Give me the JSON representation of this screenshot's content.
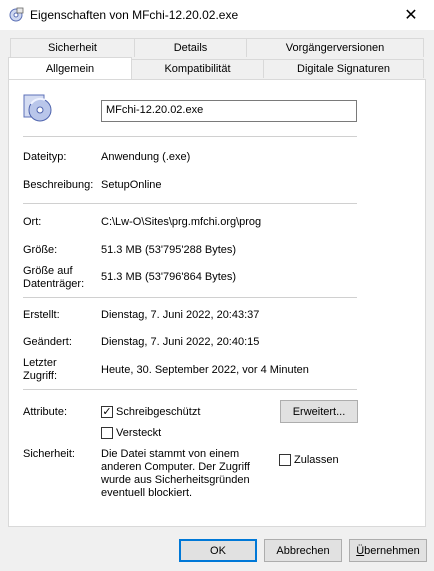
{
  "window": {
    "title": "Eigenschaften von MFchi-12.20.02.exe",
    "close_glyph": "✕"
  },
  "tabs_row1": [
    {
      "label": "Sicherheit"
    },
    {
      "label": "Details"
    },
    {
      "label": "Vorgängerversionen"
    }
  ],
  "tabs_row2": [
    {
      "label": "Allgemein",
      "active": true
    },
    {
      "label": "Kompatibilität"
    },
    {
      "label": "Digitale Signaturen"
    }
  ],
  "general": {
    "filename": "MFchi-12.20.02.exe",
    "type_label": "Dateityp:",
    "type_value": "Anwendung (.exe)",
    "desc_label": "Beschreibung:",
    "desc_value": "SetupOnline",
    "location_label": "Ort:",
    "location_value": "C:\\Lw-O\\Sites\\prg.mfchi.org\\prog",
    "size_label": "Größe:",
    "size_value": "51.3 MB (53'795'288 Bytes)",
    "disk_size_label_1": "Größe auf",
    "disk_size_label_2": "Datenträger:",
    "disk_size_value": "51.3 MB (53'796'864 Bytes)",
    "created_label": "Erstellt:",
    "created_value": "Dienstag, 7. Juni 2022, 20:43:37",
    "modified_label": "Geändert:",
    "modified_value": "Dienstag, 7. Juni 2022, 20:40:15",
    "accessed_label_1": "Letzter",
    "accessed_label_2": "Zugriff:",
    "accessed_value": "Heute, 30. September 2022, vor 4 Minuten",
    "attributes_label": "Attribute:",
    "readonly_label": "Schreibgeschützt",
    "readonly_checked": true,
    "hidden_label": "Versteckt",
    "hidden_checked": false,
    "advanced_button": "Erweitert...",
    "security_label": "Sicherheit:",
    "security_text_1": "Die Datei stammt von einem",
    "security_text_2": "anderen Computer. Der Zugriff",
    "security_text_3": "wurde aus Sicherheitsgründen",
    "security_text_4": "eventuell blockiert.",
    "unblock_label": "Zulassen",
    "unblock_checked": false
  },
  "footer": {
    "ok": "OK",
    "cancel": "Abbrechen",
    "apply_first": "Ü",
    "apply_rest": "bernehmen"
  }
}
